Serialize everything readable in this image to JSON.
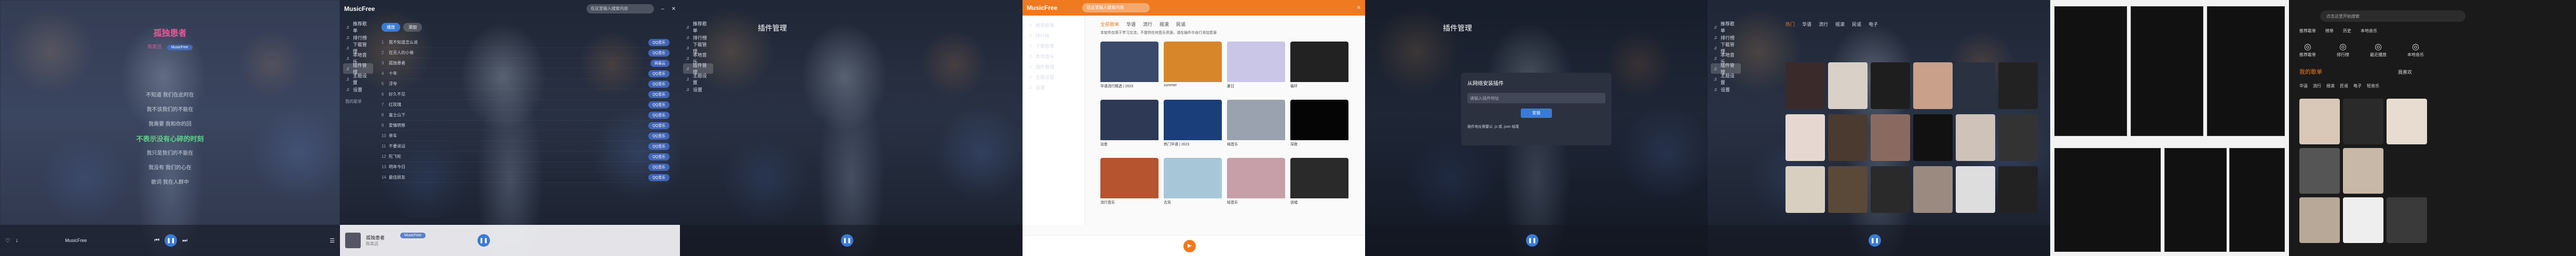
{
  "panel1": {
    "song_title": "孤独患者",
    "artist": "陈奕迅",
    "badge": "MusicFree",
    "lyrics": [
      "不知道 我们在此时在",
      "我不该我们的不能在",
      "我需要 我和你的回",
      "不表示没有心碎的时刻",
      "我只是我们的不能在",
      "我没有 我们的心在",
      "歌词 我在人群中"
    ],
    "current_lyric_index": 3,
    "player_text": "MusicFree"
  },
  "panel2": {
    "logo": "MusicFree",
    "search_placeholder": "在这里输入搜索内容",
    "play_all": "播放",
    "add": "添加",
    "sidebar": [
      "推荐歌单",
      "排行榜",
      "下载管理",
      "本地音乐",
      "插件管理",
      "主题设置",
      "设置"
    ],
    "section": "我的歌单",
    "rows": [
      {
        "title": "我不知道怎么说",
        "tag": "QQ音乐"
      },
      {
        "title": "在无人的小巷",
        "tag": "QQ音乐"
      },
      {
        "title": "孤独患者",
        "tag": "网易云"
      },
      {
        "title": "十年",
        "tag": "QQ音乐"
      },
      {
        "title": "浮夸",
        "tag": "QQ音乐"
      },
      {
        "title": "好久不见",
        "tag": "QQ音乐"
      },
      {
        "title": "红玫瑰",
        "tag": "QQ音乐"
      },
      {
        "title": "富士山下",
        "tag": "QQ音乐"
      },
      {
        "title": "爱情转移",
        "tag": "QQ音乐"
      },
      {
        "title": "单车",
        "tag": "QQ音乐"
      },
      {
        "title": "不要说话",
        "tag": "QQ音乐"
      },
      {
        "title": "陀飞轮",
        "tag": "QQ音乐"
      },
      {
        "title": "明年今日",
        "tag": "QQ音乐"
      },
      {
        "title": "最佳损友",
        "tag": "QQ音乐"
      }
    ],
    "now_playing": "孤独患者",
    "now_artist": "陈奕迅",
    "badge": "MusicFree"
  },
  "panel3": {
    "heading": "插件管理",
    "sidebar": [
      "推荐歌单",
      "排行榜",
      "下载管理",
      "本地音乐",
      "插件管理",
      "主题设置",
      "设置"
    ]
  },
  "panel4": {
    "logo": "MusicFree",
    "search_placeholder": "在这里输入搜索内容",
    "tabs": [
      "全部歌单",
      "华语",
      "流行",
      "摇滚",
      "民谣"
    ],
    "notice": "本软件仅用于学习交流，不提供任何音乐资源，请在插件中自行添加音源",
    "sidebar": [
      "推荐歌单",
      "排行榜",
      "下载管理",
      "本地音乐",
      "插件管理",
      "主题设置",
      "设置"
    ],
    "cards": [
      {
        "title": "华语流行精选 | 2023",
        "color": "#3a4a6a"
      },
      {
        "title": "summer",
        "color": "#d8862a"
      },
      {
        "title": "夏日",
        "color": "#c9c6e8"
      },
      {
        "title": "循环",
        "color": "#222"
      },
      {
        "title": "治愈",
        "color": "#2e3a55"
      },
      {
        "title": "热门华语 | 2023",
        "color": "#1a3e7a"
      },
      {
        "title": "纯音乐",
        "color": "#9aa2b0"
      },
      {
        "title": "深夜",
        "color": "#050505"
      },
      {
        "title": "流行音乐",
        "color": "#b5542e"
      },
      {
        "title": "古风",
        "color": "#a7c7d9"
      },
      {
        "title": "轻音乐",
        "color": "#c79fa8"
      },
      {
        "title": "说唱",
        "color": "#2a2a2a"
      }
    ]
  },
  "panel5": {
    "heading": "插件管理",
    "dialog_title": "从网络安装插件",
    "dialog_placeholder": "请输入插件地址",
    "dialog_button": "安装",
    "dialog_hint": "插件地址需要以 .js 或 .json 结尾"
  },
  "panel6": {
    "tabs": [
      "热门",
      "华语",
      "流行",
      "摇滚",
      "民谣",
      "电子"
    ],
    "sidebar": [
      "推荐歌单",
      "排行榜",
      "下载管理",
      "本地音乐",
      "插件管理",
      "主题设置",
      "设置"
    ]
  },
  "panel8": {
    "search_placeholder": "点击这里开始搜索",
    "menu": [
      "推荐歌单",
      "榜单",
      "历史",
      "本地音乐"
    ],
    "icons": [
      "推荐歌单",
      "排行榜",
      "最近播放",
      "本地音乐"
    ],
    "my_lists": "我的歌单",
    "my_fav": "我喜欢",
    "tags": [
      "华语",
      "流行",
      "摇滚",
      "民谣",
      "电子",
      "轻音乐"
    ]
  }
}
